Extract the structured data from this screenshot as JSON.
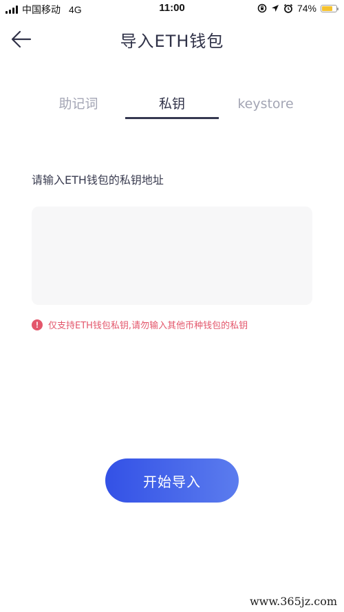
{
  "status_bar": {
    "carrier": "中国移动",
    "network": "4G",
    "time": "11:00",
    "battery": "74%",
    "battery_level": 0.74,
    "battery_color": "#f5c22e"
  },
  "header": {
    "title": "导入ETH钱包",
    "back_icon": "arrow-left-icon"
  },
  "tabs": [
    {
      "label": "助记词",
      "active": false
    },
    {
      "label": "私钥",
      "active": true
    },
    {
      "label": "keystore",
      "active": false
    }
  ],
  "form": {
    "label": "请输入ETH钱包的私钥地址",
    "value": "",
    "warning": "仅支持ETH钱包私钥,请勿输入其他币种钱包的私钥",
    "warning_color": "#e3566b"
  },
  "actions": {
    "start_import": "开始导入",
    "accent": "#3351e6"
  },
  "watermark": "www.365jz.com"
}
